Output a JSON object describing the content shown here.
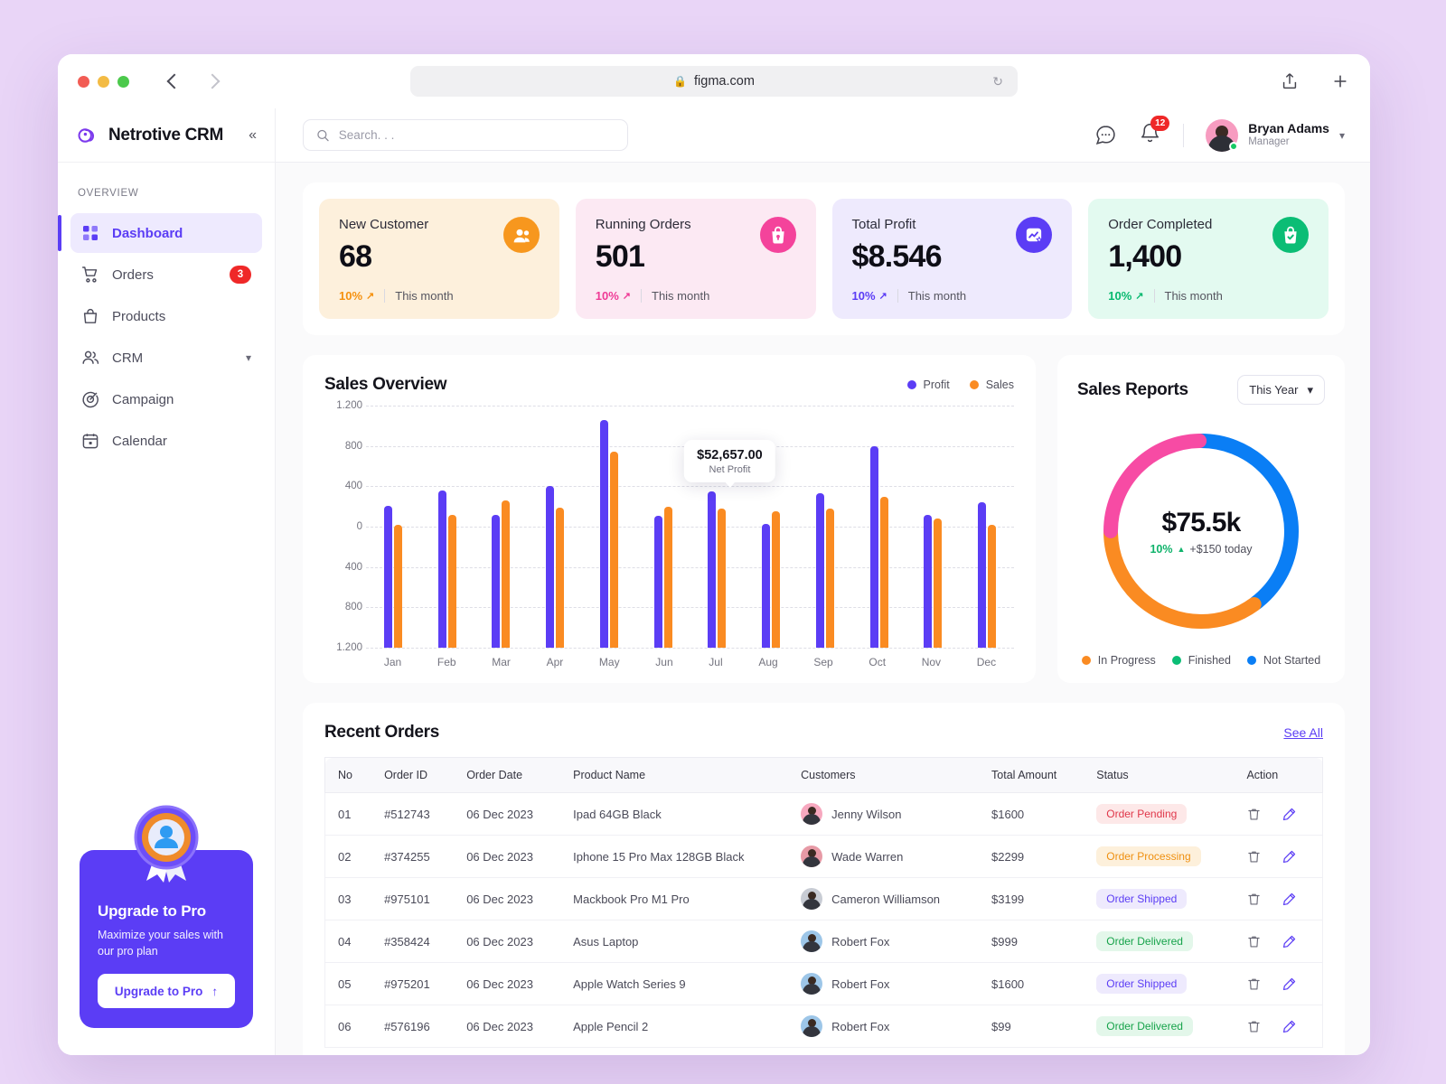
{
  "browser": {
    "url_host": "figma.com",
    "lock_icon": "lock-icon",
    "reload_icon": "reload-icon",
    "back_icon": "back-arrow-icon",
    "forward_icon": "forward-arrow-icon",
    "share_icon": "share-icon",
    "newtab_icon": "plus-icon"
  },
  "sidebar": {
    "brand": "Netrotive CRM",
    "collapse_icon": "chevron-double-left-icon",
    "section_label": "OVERVIEW",
    "items": [
      {
        "label": "Dashboard",
        "icon": "grid-icon",
        "active": true,
        "badge": ""
      },
      {
        "label": "Orders",
        "icon": "cart-icon",
        "active": false,
        "badge": "3"
      },
      {
        "label": "Products",
        "icon": "bag-icon",
        "active": false,
        "badge": ""
      },
      {
        "label": "CRM",
        "icon": "users-icon",
        "active": false,
        "badge": "",
        "chevron": true
      },
      {
        "label": "Campaign",
        "icon": "target-icon",
        "active": false,
        "badge": ""
      },
      {
        "label": "Calendar",
        "icon": "calendar-icon",
        "active": false,
        "badge": ""
      }
    ],
    "upgrade": {
      "title": "Upgrade to Pro",
      "desc": "Maximize your sales with our pro plan",
      "button": "Upgrade to Pro",
      "button_icon": "arrow-up-icon",
      "medal_icon": "medal-badge-icon"
    }
  },
  "topbar": {
    "search_placeholder": "Search. . .",
    "search_value": "",
    "search_icon": "search-icon",
    "chat_icon": "chat-bubble-icon",
    "bell_icon": "bell-icon",
    "notification_count": "12",
    "user_name": "Bryan Adams",
    "user_role": "Manager",
    "chevron_icon": "chevron-down-icon"
  },
  "stats": [
    {
      "title": "New Customer",
      "value": "68",
      "pct": "10%",
      "period": "This month",
      "icon": "people-icon",
      "bg": "#fdf0dc",
      "accent": "#f5910f",
      "icon_bg": "#f7971e"
    },
    {
      "title": "Running Orders",
      "value": "501",
      "pct": "10%",
      "period": "This month",
      "icon": "bag-lock-icon",
      "bg": "#fce9f3",
      "accent": "#ef3b96",
      "icon_bg": "#f4439b"
    },
    {
      "title": "Total Profit",
      "value": "$8.546",
      "pct": "10%",
      "period": "This month",
      "icon": "chart-star-icon",
      "bg": "#eeeafd",
      "accent": "#5b3df5",
      "icon_bg": "#5b3df5"
    },
    {
      "title": "Order Completed",
      "value": "1,400",
      "pct": "10%",
      "period": "This month",
      "icon": "bag-check-icon",
      "bg": "#e3faf0",
      "accent": "#07b96f",
      "icon_bg": "#0bbd75"
    }
  ],
  "sales_overview": {
    "title": "Sales Overview",
    "tooltip_value": "$52,657.00",
    "tooltip_label": "Net Profit"
  },
  "sales_reports": {
    "title": "Sales Reports",
    "range": "This Year",
    "chevron_icon": "chevron-down-icon",
    "total": "$75.5k",
    "pct": "10%",
    "trend_icon": "triangle-up-icon",
    "delta": "+$150 today"
  },
  "orders": {
    "title": "Recent Orders",
    "see_all": "See All",
    "columns": [
      "No",
      "Order ID",
      "Order Date",
      "Product Name",
      "Customers",
      "Total Amount",
      "Status",
      "Action"
    ],
    "delete_icon": "trash-icon",
    "edit_icon": "pencil-icon",
    "rows": [
      {
        "no": "01",
        "id": "#512743",
        "date": "06 Dec 2023",
        "product": "Ipad 64GB Black",
        "customer": "Jenny Wilson",
        "avatar_bg": "#f7a8bf",
        "amount": "$1600",
        "status": "Order Pending",
        "status_bg": "#fde8e8",
        "status_fg": "#e0374a"
      },
      {
        "no": "02",
        "id": "#374255",
        "date": "06 Dec 2023",
        "product": "Iphone 15 Pro Max 128GB Black",
        "customer": "Wade Warren",
        "avatar_bg": "#e79aa6",
        "amount": "$2299",
        "status": "Order Processing",
        "status_bg": "#fdf0db",
        "status_fg": "#ef9011"
      },
      {
        "no": "03",
        "id": "#975101",
        "date": "06 Dec 2023",
        "product": "Mackbook Pro M1 Pro",
        "customer": "Cameron Williamson",
        "avatar_bg": "#c8ccd4",
        "amount": "$3199",
        "status": "Order Shipped",
        "status_bg": "#eeeafd",
        "status_fg": "#5b3df5"
      },
      {
        "no": "04",
        "id": "#358424",
        "date": "06 Dec 2023",
        "product": "Asus Laptop",
        "customer": "Robert Fox",
        "avatar_bg": "#9dc6e8",
        "amount": "$999",
        "status": "Order Delivered",
        "status_bg": "#e3f7ea",
        "status_fg": "#16a34a"
      },
      {
        "no": "05",
        "id": "#975201",
        "date": "06 Dec 2023",
        "product": "Apple Watch Series 9",
        "customer": "Robert Fox",
        "avatar_bg": "#9dc6e8",
        "amount": "$1600",
        "status": "Order Shipped",
        "status_bg": "#eeeafd",
        "status_fg": "#5b3df5"
      },
      {
        "no": "06",
        "id": "#576196",
        "date": "06 Dec 2023",
        "product": "Apple Pencil 2",
        "customer": "Robert Fox",
        "avatar_bg": "#9dc6e8",
        "amount": "$99",
        "status": "Order Delivered",
        "status_bg": "#e3f7ea",
        "status_fg": "#16a34a"
      }
    ]
  },
  "chart_data": [
    {
      "type": "bar",
      "title": "Sales Overview",
      "categories": [
        "Jan",
        "Feb",
        "Mar",
        "Apr",
        "May",
        "Jun",
        "Jul",
        "Aug",
        "Sep",
        "Oct",
        "Nov",
        "Dec"
      ],
      "series": [
        {
          "name": "Profit",
          "color": "#5b3df5",
          "values": [
            210,
            360,
            120,
            400,
            1060,
            110,
            350,
            30,
            330,
            800,
            120,
            240
          ]
        },
        {
          "name": "Sales",
          "color": "#fa8b22",
          "values": [
            20,
            120,
            260,
            190,
            740,
            200,
            180,
            150,
            180,
            300,
            80,
            20
          ]
        }
      ],
      "ylabel": "",
      "xlabel": "",
      "ytick_labels": [
        "1.200",
        "800",
        "400",
        "0",
        "400",
        "800",
        "1.200"
      ],
      "ylim": [
        -1200,
        1200
      ],
      "grid": true,
      "legend_position": "top-right",
      "annotation": {
        "category": "Jul",
        "value": "$52,657.00",
        "label": "Net Profit"
      }
    },
    {
      "type": "pie",
      "title": "Sales Reports",
      "subtitle": "This Year",
      "center_value": "$75.5k",
      "center_note": "10% +$150 today",
      "labels": [
        "In Progress",
        "Finished",
        "Not Started"
      ],
      "legend_colors": [
        "#fa8b22",
        "#0bbd75",
        "#0a7ef5"
      ],
      "segments": [
        {
          "name": "Not Started",
          "color": "#0a7ef5",
          "percent": 40
        },
        {
          "name": "In Progress",
          "color": "#fa8b22",
          "percent": 35
        },
        {
          "name": "Finished",
          "color": "#f74ba4",
          "percent": 25
        }
      ],
      "legend_position": "bottom"
    }
  ]
}
